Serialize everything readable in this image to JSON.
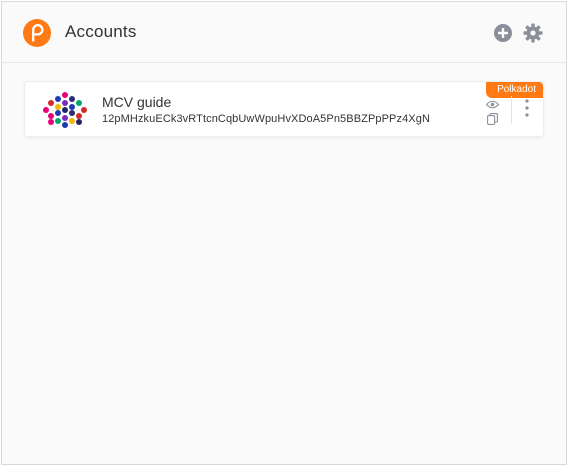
{
  "header": {
    "title": "Accounts",
    "logo_icon": "polkadot-p-logo-icon",
    "actions": [
      {
        "icon": "add-circle-icon"
      },
      {
        "icon": "gear-icon"
      }
    ]
  },
  "accounts": [
    {
      "name": "MCV guide",
      "address": "12pMHzkuECk3vRTtcnCqbUwWpuHvXDoA5Pn5BBZPpPPz4XgN",
      "network": "Polkadot",
      "icons": [
        "identicon",
        "eye-icon",
        "copy-icon",
        "vertical-dots-icon"
      ]
    }
  ],
  "colors": {
    "accent": "#ff7a14",
    "text": "#333333",
    "icon_gray": "#8a8f99",
    "background": "#fafafa"
  }
}
